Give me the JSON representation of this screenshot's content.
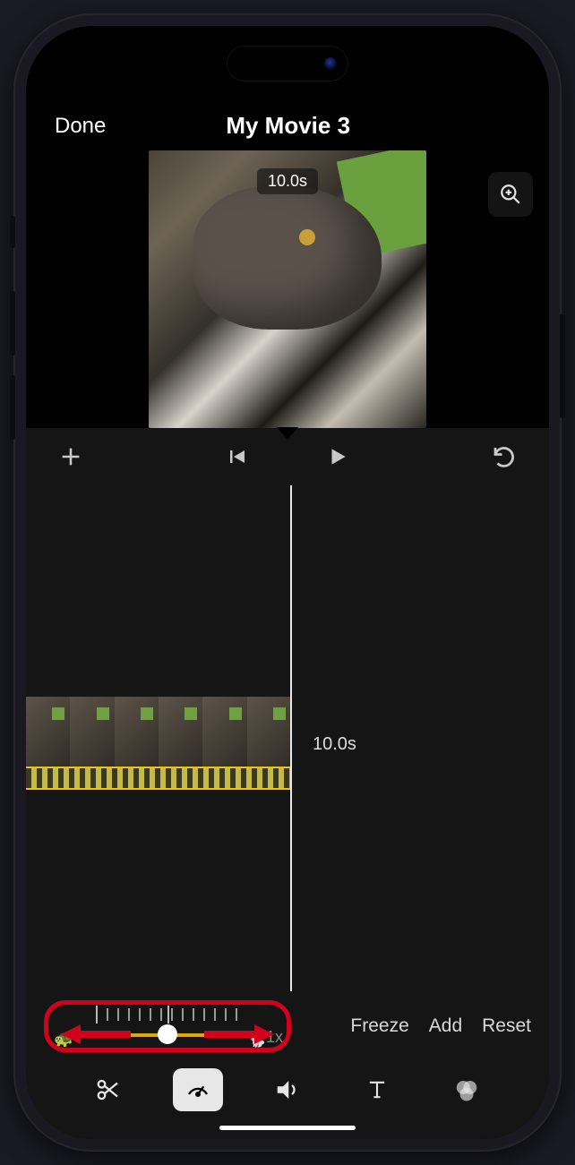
{
  "topbar": {
    "done": "Done",
    "title": "My Movie 3"
  },
  "preview": {
    "duration_badge": "10.0s"
  },
  "timeline": {
    "duration_label": "10.0s"
  },
  "speed": {
    "multiplier": "1x",
    "freeze": "Freeze",
    "add": "Add",
    "reset": "Reset"
  }
}
